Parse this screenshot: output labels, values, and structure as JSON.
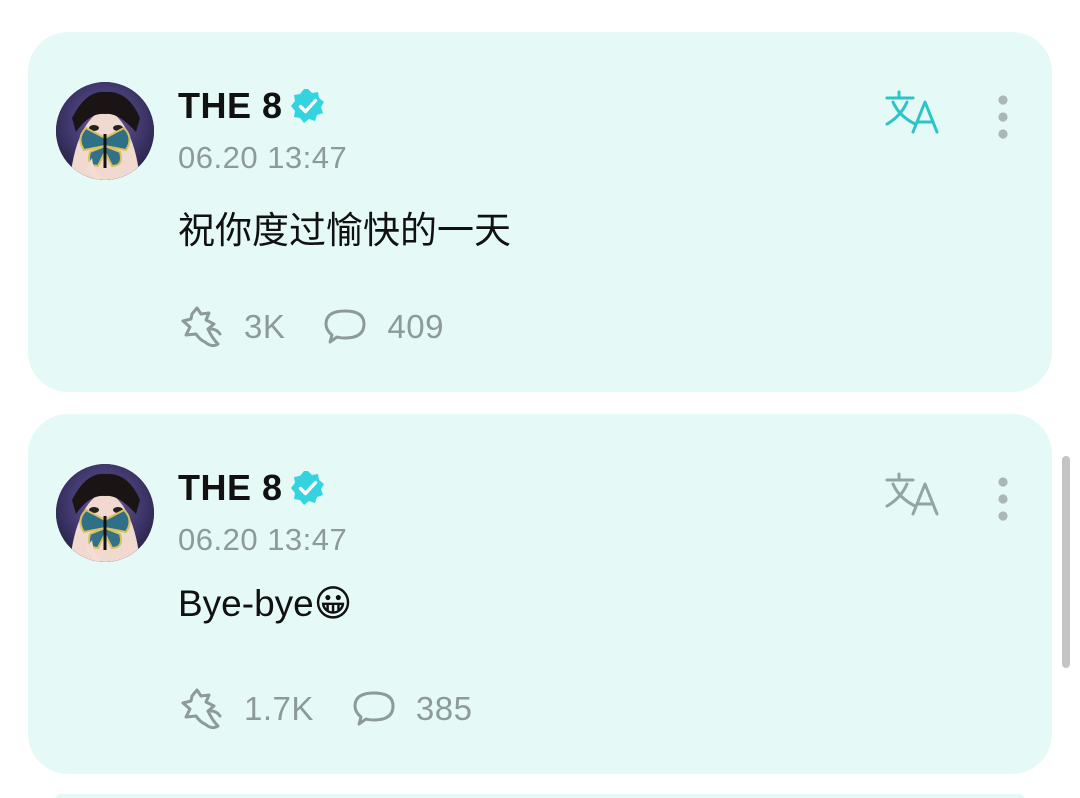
{
  "colors": {
    "card_bg": "#e5faf7",
    "accent": "#33c7cc",
    "muted": "#8d9a99",
    "text": "#111111"
  },
  "posts": [
    {
      "author": "THE 8",
      "verified": true,
      "timestamp": "06.20 13:47",
      "text": "祝你度过愉快的一天",
      "reactions_count": "3K",
      "comments_count": "409",
      "translate_icon": "translate-icon",
      "translate_color": "#2bc4c9",
      "more_icon": "more-vertical-icon"
    },
    {
      "author": "THE 8",
      "verified": true,
      "timestamp": "06.20 13:47",
      "text": "Bye-bye😀",
      "reactions_count": "1.7K",
      "comments_count": "385",
      "translate_icon": "translate-icon",
      "translate_color": "#8fa6a4",
      "more_icon": "more-vertical-icon"
    }
  ]
}
